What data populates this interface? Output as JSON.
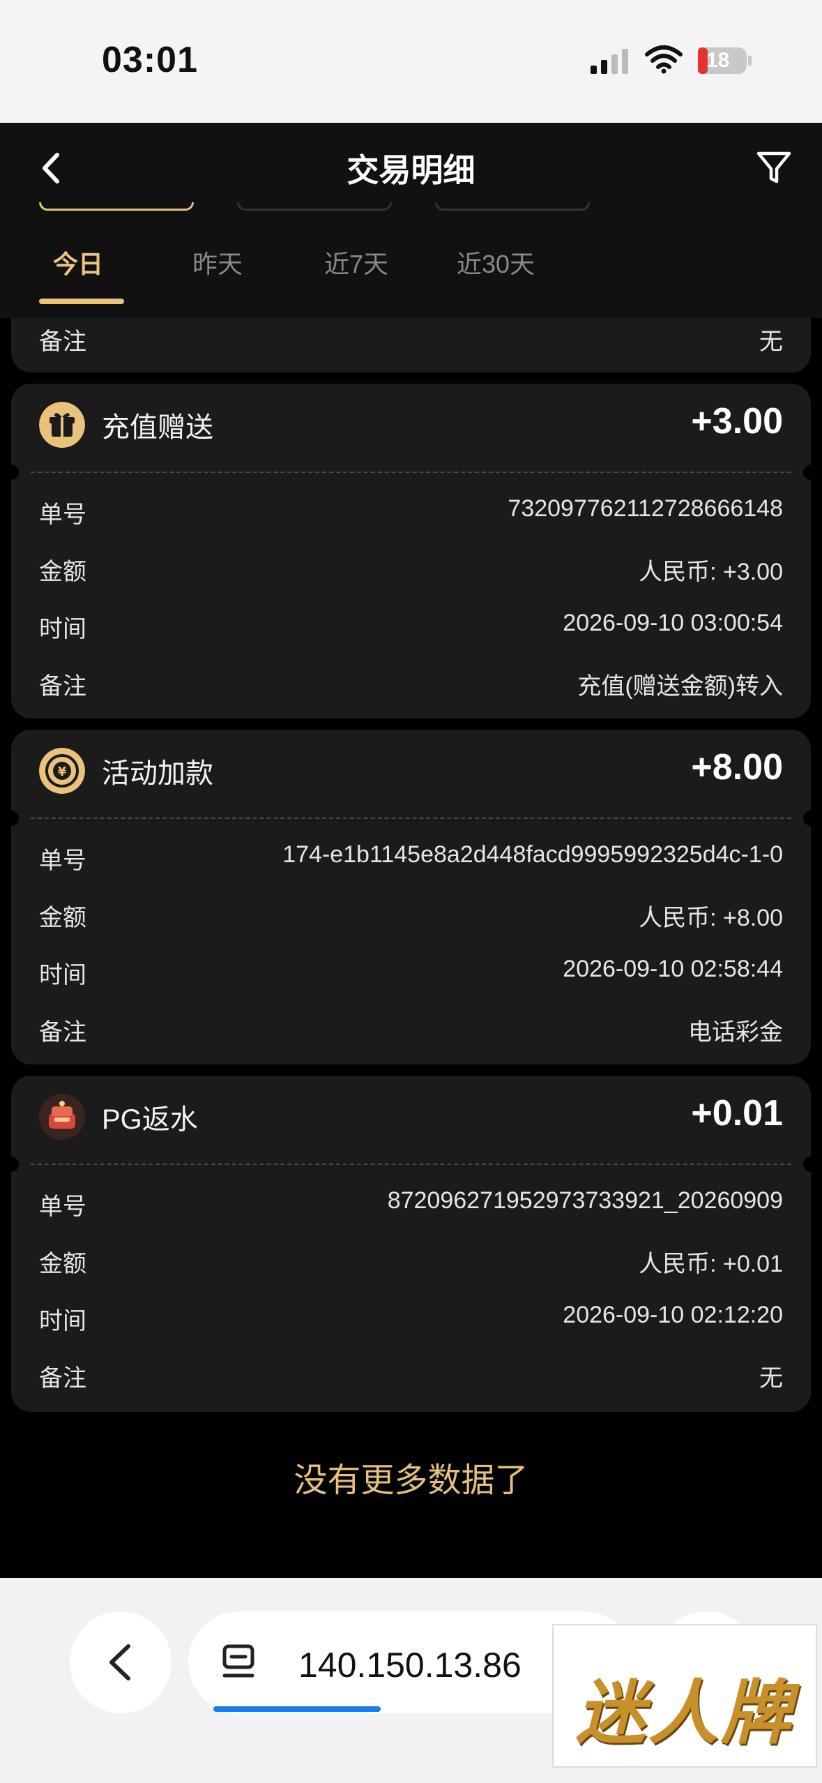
{
  "status_bar": {
    "time": "03:01",
    "battery": "18"
  },
  "header": {
    "title": "交易明细"
  },
  "tabs": [
    "今日",
    "昨天",
    "近7天",
    "近30天"
  ],
  "partial_card": {
    "label": "备注",
    "value": "无"
  },
  "cards": [
    {
      "type": "充值赠送",
      "amount": "+3.00",
      "icon": "gift-icon",
      "rows": [
        {
          "label": "单号",
          "value": "7320977621127286661​48"
        },
        {
          "label": "金额",
          "value": "人民币: +3.00"
        },
        {
          "label": "时间",
          "value": "2026-09-10 03:00:54"
        },
        {
          "label": "备注",
          "value": "充值(赠送金额)转入"
        }
      ]
    },
    {
      "type": "活动加款",
      "amount": "+8.00",
      "icon": "coin-activity-icon",
      "rows": [
        {
          "label": "单号",
          "value": "174-e1b1145e8a2d448facd9995992325d4c-1-0"
        },
        {
          "label": "金额",
          "value": "人民币: +8.00"
        },
        {
          "label": "时间",
          "value": "2026-09-10 02:58:44"
        },
        {
          "label": "备注",
          "value": "电话彩金"
        }
      ]
    },
    {
      "type": "PG返水",
      "amount": "+0.01",
      "icon": "pg-game-icon",
      "rows": [
        {
          "label": "单号",
          "value": "8720962719529737339​21_20260909"
        },
        {
          "label": "金额",
          "value": "人民币: +0.01"
        },
        {
          "label": "时间",
          "value": "2026-09-10 02:12:20"
        },
        {
          "label": "备注",
          "value": "无"
        }
      ]
    }
  ],
  "footer": {
    "no_more": "没有更多数据了"
  },
  "browser": {
    "url": "140.150.13.86"
  },
  "watermark": {
    "text": "迷人牌"
  },
  "colors": {
    "accent_gold": "#e9c27c",
    "card_bg": "#1b1b1c",
    "progress_blue": "#1a7cf0"
  }
}
